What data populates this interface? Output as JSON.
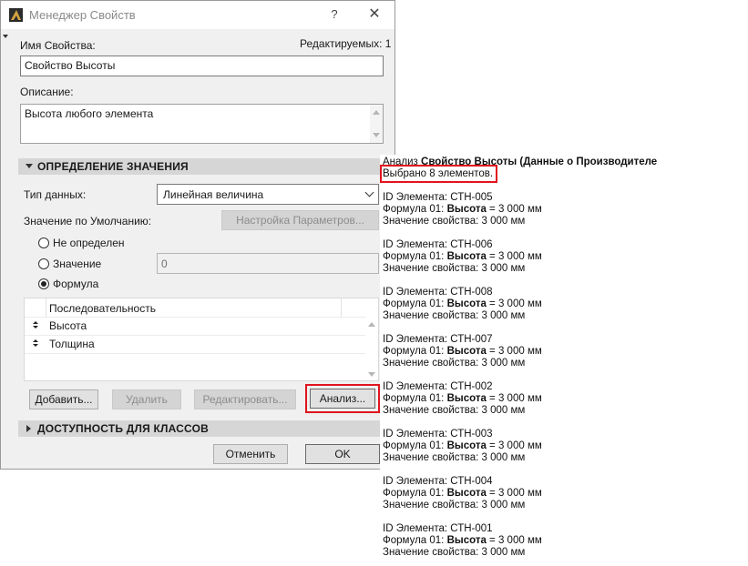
{
  "dialog": {
    "title": "Менеджер Свойств",
    "help": "?",
    "close": "✕",
    "property_name_label": "Имя Свойства:",
    "editable_label": "Редактируемых: 1",
    "property_name_value": "Свойство Высоты",
    "description_label": "Описание:",
    "description_value": "Высота любого элемента",
    "value_section": "ОПРЕДЕЛЕНИЕ ЗНАЧЕНИЯ",
    "data_type_label": "Тип данных:",
    "data_type_value": "Линейная величина",
    "default_value_label": "Значение по Умолчанию:",
    "settings_button": "Настройка Параметров...",
    "radios": {
      "undefined": "Не определен",
      "value": "Значение",
      "formula": "Формула"
    },
    "value_input": "0",
    "list": {
      "header": "Последовательность",
      "rows": [
        "Высота",
        "Толщина"
      ]
    },
    "buttons": {
      "add": "Добавить...",
      "delete": "Удалить",
      "edit": "Редактировать...",
      "analyze": "Анализ..."
    },
    "classes_section": "ДОСТУПНОСТЬ ДЛЯ КЛАССОВ",
    "cancel": "Отменить",
    "ok": "OK"
  },
  "analysis": {
    "title_prefix": "Анализ ",
    "title_bold": "Свойство Высоты (Данные о Производителе",
    "selected": "Выбрано 8 элементов.",
    "id_prefix": "ID Элемента: ",
    "formula_prefix": "Формула 01: ",
    "formula_bold": "Высота",
    "formula_suffix": " = 3 000 мм",
    "value_line": "Значение свойства: 3 000 мм",
    "items": [
      {
        "id": "СТН-005"
      },
      {
        "id": "СТН-006"
      },
      {
        "id": "СТН-008"
      },
      {
        "id": "СТН-007"
      },
      {
        "id": "СТН-002"
      },
      {
        "id": "СТН-003"
      },
      {
        "id": "СТН-004"
      },
      {
        "id": "СТН-001"
      }
    ]
  },
  "colors": {
    "highlight": "#e0141e",
    "section_bg": "#d6d6d6",
    "dialog_bg": "#f0f0f0"
  }
}
